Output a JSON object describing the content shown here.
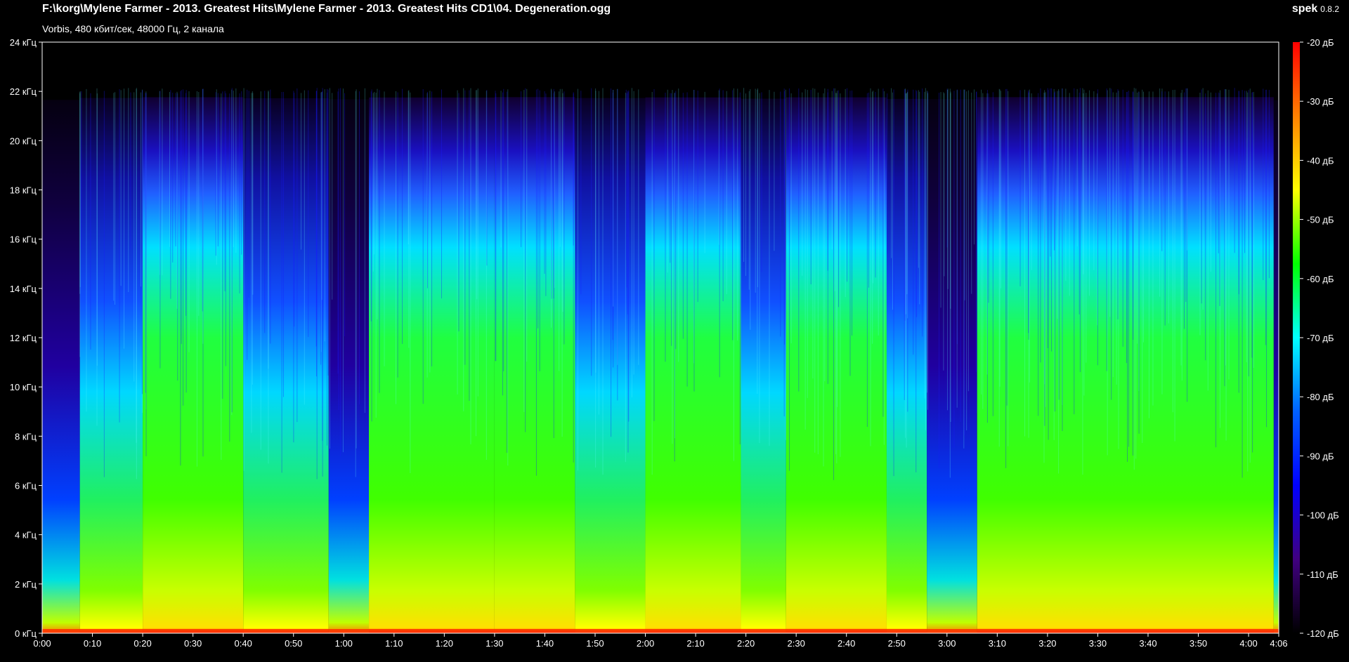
{
  "header": {
    "file_path": "F:\\korg\\Mylene Farmer - 2013. Greatest Hits\\Mylene Farmer - 2013. Greatest Hits CD1\\04. Degeneration.ogg",
    "stream_info": "Vorbis, 480 кбит/сек, 48000 Гц, 2 канала",
    "app_name": "spek",
    "app_version": "0.8.2"
  },
  "spectrogram": {
    "duration_seconds": 246,
    "max_freq_khz": 24,
    "effective_cutoff_khz": 21.8,
    "db_range": [
      -120,
      -20
    ]
  },
  "freq_axis": {
    "ticks": [
      {
        "value": 24,
        "label": "24 кГц"
      },
      {
        "value": 22,
        "label": "22 кГц"
      },
      {
        "value": 20,
        "label": "20 кГц"
      },
      {
        "value": 18,
        "label": "18 кГц"
      },
      {
        "value": 16,
        "label": "16 кГц"
      },
      {
        "value": 14,
        "label": "14 кГц"
      },
      {
        "value": 12,
        "label": "12 кГц"
      },
      {
        "value": 10,
        "label": "10 кГц"
      },
      {
        "value": 8,
        "label": "8 кГц"
      },
      {
        "value": 6,
        "label": "6 кГц"
      },
      {
        "value": 4,
        "label": "4 кГц"
      },
      {
        "value": 2,
        "label": "2 кГц"
      },
      {
        "value": 0,
        "label": "0 кГц"
      }
    ]
  },
  "time_axis": {
    "ticks": [
      {
        "value": 0,
        "label": "0:00"
      },
      {
        "value": 10,
        "label": "0:10"
      },
      {
        "value": 20,
        "label": "0:20"
      },
      {
        "value": 30,
        "label": "0:30"
      },
      {
        "value": 40,
        "label": "0:40"
      },
      {
        "value": 50,
        "label": "0:50"
      },
      {
        "value": 60,
        "label": "1:00"
      },
      {
        "value": 70,
        "label": "1:10"
      },
      {
        "value": 80,
        "label": "1:20"
      },
      {
        "value": 90,
        "label": "1:30"
      },
      {
        "value": 100,
        "label": "1:40"
      },
      {
        "value": 110,
        "label": "1:50"
      },
      {
        "value": 120,
        "label": "2:00"
      },
      {
        "value": 130,
        "label": "2:10"
      },
      {
        "value": 140,
        "label": "2:20"
      },
      {
        "value": 150,
        "label": "2:30"
      },
      {
        "value": 160,
        "label": "2:40"
      },
      {
        "value": 170,
        "label": "2:50"
      },
      {
        "value": 180,
        "label": "3:00"
      },
      {
        "value": 190,
        "label": "3:10"
      },
      {
        "value": 200,
        "label": "3:20"
      },
      {
        "value": 210,
        "label": "3:30"
      },
      {
        "value": 220,
        "label": "3:40"
      },
      {
        "value": 230,
        "label": "3:50"
      },
      {
        "value": 240,
        "label": "4:00"
      },
      {
        "value": 246,
        "label": "4:06"
      }
    ]
  },
  "db_scale": {
    "ticks": [
      {
        "value": -20,
        "label": "-20 дБ"
      },
      {
        "value": -30,
        "label": "-30 дБ"
      },
      {
        "value": -40,
        "label": "-40 дБ"
      },
      {
        "value": -50,
        "label": "-50 дБ"
      },
      {
        "value": -60,
        "label": "-60 дБ"
      },
      {
        "value": -70,
        "label": "-70 дБ"
      },
      {
        "value": -80,
        "label": "-80 дБ"
      },
      {
        "value": -90,
        "label": "-90 дБ"
      },
      {
        "value": -100,
        "label": "-100 дБ"
      },
      {
        "value": -110,
        "label": "-110 дБ"
      },
      {
        "value": -120,
        "label": "-120 дБ"
      }
    ],
    "colors": [
      "#ff0000",
      "#ff8000",
      "#ffff00",
      "#00ff00",
      "#00ffff",
      "#0060ff",
      "#0000ff",
      "#400080",
      "#000000"
    ]
  },
  "segments": [
    {
      "start": 0,
      "end": 7.5,
      "level": 0.15
    },
    {
      "start": 7.5,
      "end": 20,
      "level": 0.62
    },
    {
      "start": 20,
      "end": 40,
      "level": 0.78
    },
    {
      "start": 40,
      "end": 57,
      "level": 0.55
    },
    {
      "start": 57,
      "end": 65,
      "level": 0.3
    },
    {
      "start": 65,
      "end": 90,
      "level": 0.72
    },
    {
      "start": 90,
      "end": 106,
      "level": 0.8
    },
    {
      "start": 106,
      "end": 120,
      "level": 0.6
    },
    {
      "start": 120,
      "end": 139,
      "level": 0.74
    },
    {
      "start": 139,
      "end": 148,
      "level": 0.45
    },
    {
      "start": 148,
      "end": 168,
      "level": 0.76
    },
    {
      "start": 168,
      "end": 176,
      "level": 0.4
    },
    {
      "start": 176,
      "end": 186,
      "level": 0.35
    },
    {
      "start": 186,
      "end": 245,
      "level": 0.8
    },
    {
      "start": 245,
      "end": 246,
      "level": 0.1
    }
  ]
}
